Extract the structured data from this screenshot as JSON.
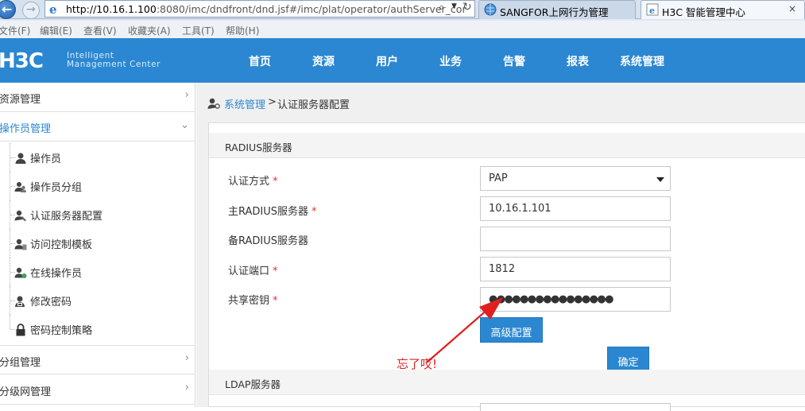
{
  "browser": {
    "url_host": "http://10.16.1.100",
    "url_rest": ":8080/imc/dndfront/dnd.jsf#/imc/plat/operator/authServer_cor",
    "tabs": [
      {
        "label": "SANGFOR上网行为管理"
      },
      {
        "label": "H3C 智能管理中心"
      }
    ],
    "close_glyph": "×",
    "menu": [
      "文件(F)",
      "编辑(E)",
      "查看(V)",
      "收藏夹(A)",
      "工具(T)",
      "帮助(H)"
    ]
  },
  "header": {
    "logo": "H3C",
    "logo_line1": "Intelligent",
    "logo_line2": "Management Center",
    "nav": [
      "首页",
      "资源",
      "用户",
      "业务",
      "告警",
      "报表",
      "系统管理"
    ]
  },
  "sidebar": {
    "groups": {
      "resource": "资源管理",
      "operator": "操作员管理",
      "group": "分组管理",
      "hierarchy": "分级网管理"
    },
    "items": [
      {
        "label": "操作员",
        "icon": "user-icon"
      },
      {
        "label": "操作员分组",
        "icon": "user-group-icon"
      },
      {
        "label": "认证服务器配置",
        "icon": "auth-server-icon"
      },
      {
        "label": "访问控制模板",
        "icon": "access-template-icon"
      },
      {
        "label": "在线操作员",
        "icon": "online-user-icon"
      },
      {
        "label": "修改密码",
        "icon": "change-password-icon"
      },
      {
        "label": "密码控制策略",
        "icon": "lock-icon"
      }
    ]
  },
  "breadcrumb": {
    "link": "系统管理",
    "separator": ">",
    "current": "认证服务器配置"
  },
  "radius": {
    "title": "RADIUS服务器",
    "auth_method": {
      "label": "认证方式",
      "value": "PAP"
    },
    "primary_server": {
      "label": "主RADIUS服务器",
      "value": "10.16.1.101"
    },
    "backup_server": {
      "label": "备RADIUS服务器",
      "value": ""
    },
    "auth_port": {
      "label": "认证端口",
      "value": "1812"
    },
    "shared_key": {
      "label": "共享密钥",
      "value": "●●●●●●●●●●●●●●●●"
    },
    "required_mark": "*",
    "advanced_button": "高级配置",
    "ok_button": "确定"
  },
  "ldap": {
    "title": "LDAP服务器"
  },
  "annotation": {
    "text": "忘了哎!",
    "color": "#e02020"
  },
  "colors": {
    "accent": "#2b87d1",
    "required": "#e03030"
  }
}
